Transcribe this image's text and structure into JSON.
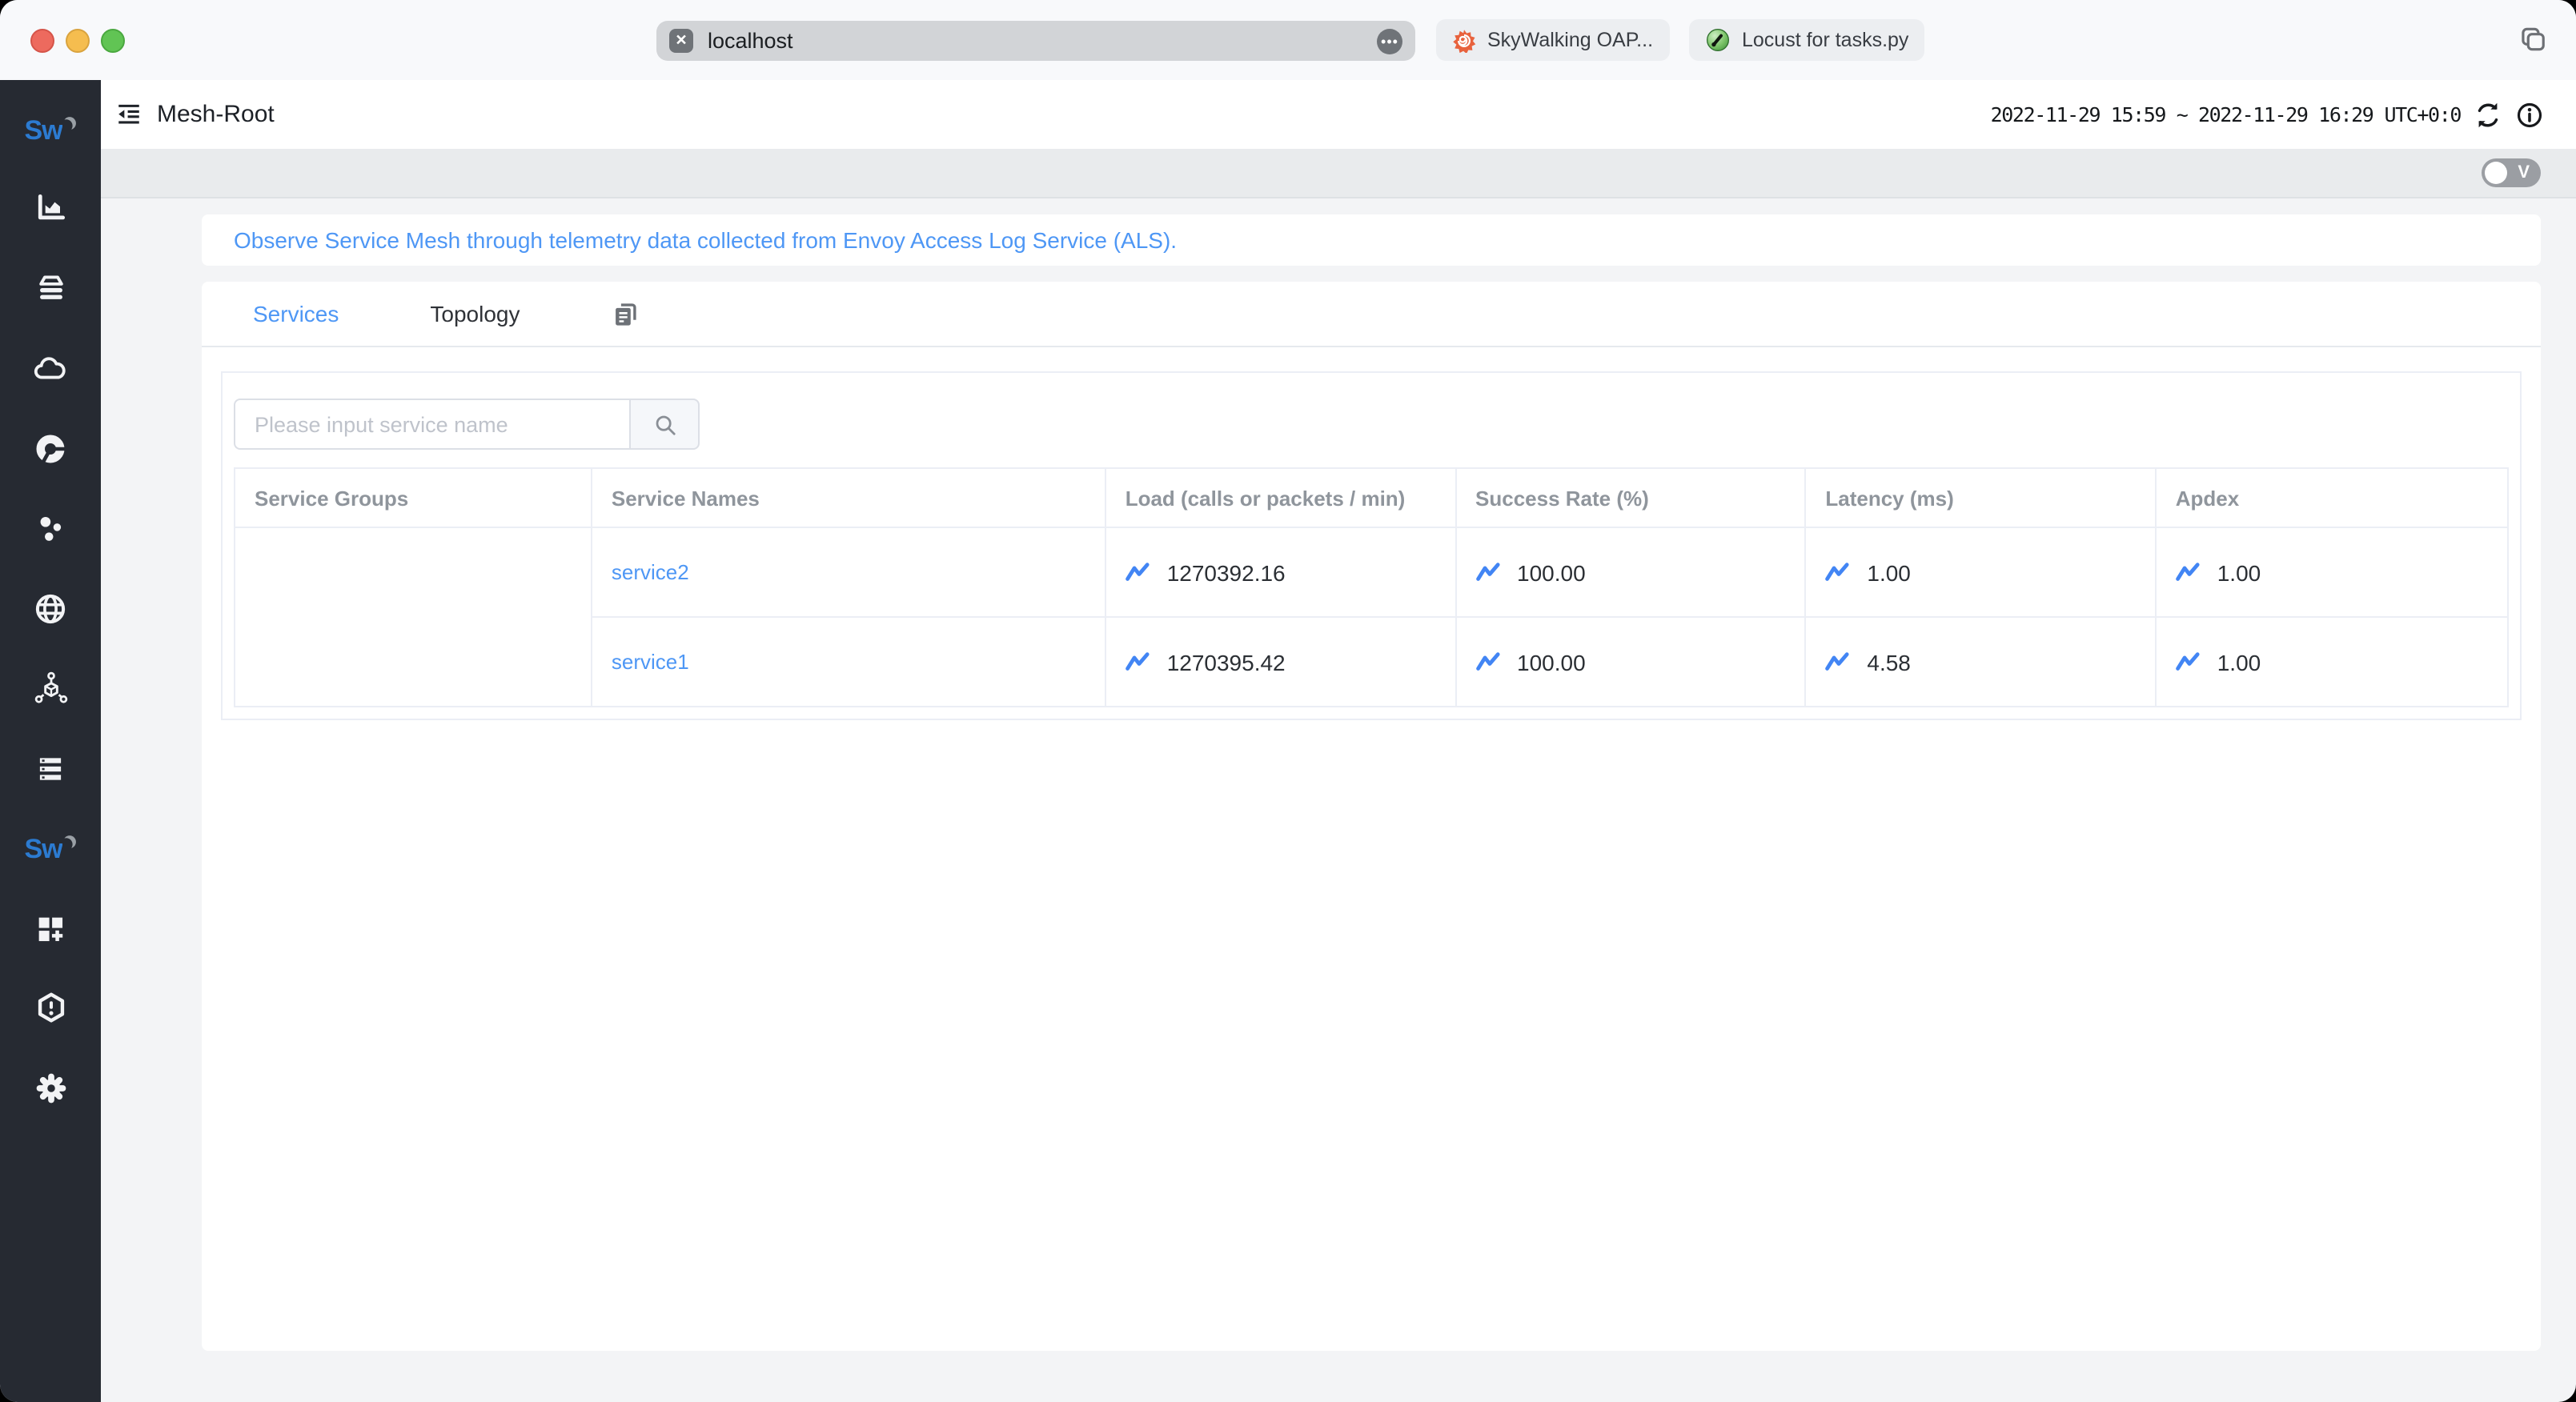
{
  "colors": {
    "accent_blue": "#4e97f5",
    "trend_blue": "#4285f4",
    "sidebar_bg": "#262a32",
    "logo_blue": "#2c7bd1",
    "skywalking_orange": "#e8623d",
    "locust_green": "#6cbf5a",
    "traffic_red": "#ed6a5e",
    "traffic_yellow": "#f5bd4f",
    "traffic_green": "#61c454"
  },
  "browser": {
    "url": "localhost",
    "tabs": [
      {
        "label": "SkyWalking OAP..."
      },
      {
        "label": "Locust for tasks.py"
      }
    ]
  },
  "sidebar": {
    "items": [
      {
        "name": "skywalking-logo"
      },
      {
        "name": "general-service"
      },
      {
        "name": "database"
      },
      {
        "name": "cloud"
      },
      {
        "name": "profile"
      },
      {
        "name": "bubbles"
      },
      {
        "name": "browser"
      },
      {
        "name": "service-mesh"
      },
      {
        "name": "infrastructure"
      },
      {
        "name": "skywalking-active"
      },
      {
        "name": "new-dashboard"
      },
      {
        "name": "alerting"
      },
      {
        "name": "settings"
      }
    ]
  },
  "header": {
    "title": "Mesh-Root",
    "time_range": "2022-11-29 15:59 ~ 2022-11-29 16:29",
    "timezone": "UTC+0:0"
  },
  "controls": {
    "version_toggle_label": "V"
  },
  "banner": {
    "text": "Observe Service Mesh through telemetry data collected from Envoy Access Log Service (ALS)."
  },
  "tabbar": {
    "services": "Services",
    "topology": "Topology"
  },
  "search": {
    "placeholder": "Please input service name"
  },
  "table": {
    "columns": [
      "Service Groups",
      "Service Names",
      "Load (calls or packets / min)",
      "Success Rate (%)",
      "Latency (ms)",
      "Apdex"
    ],
    "rows": [
      {
        "group": "",
        "name": "service2",
        "load": "1270392.16",
        "success_rate": "100.00",
        "latency": "1.00",
        "apdex": "1.00"
      },
      {
        "group": "",
        "name": "service1",
        "load": "1270395.42",
        "success_rate": "100.00",
        "latency": "4.58",
        "apdex": "1.00"
      }
    ]
  }
}
